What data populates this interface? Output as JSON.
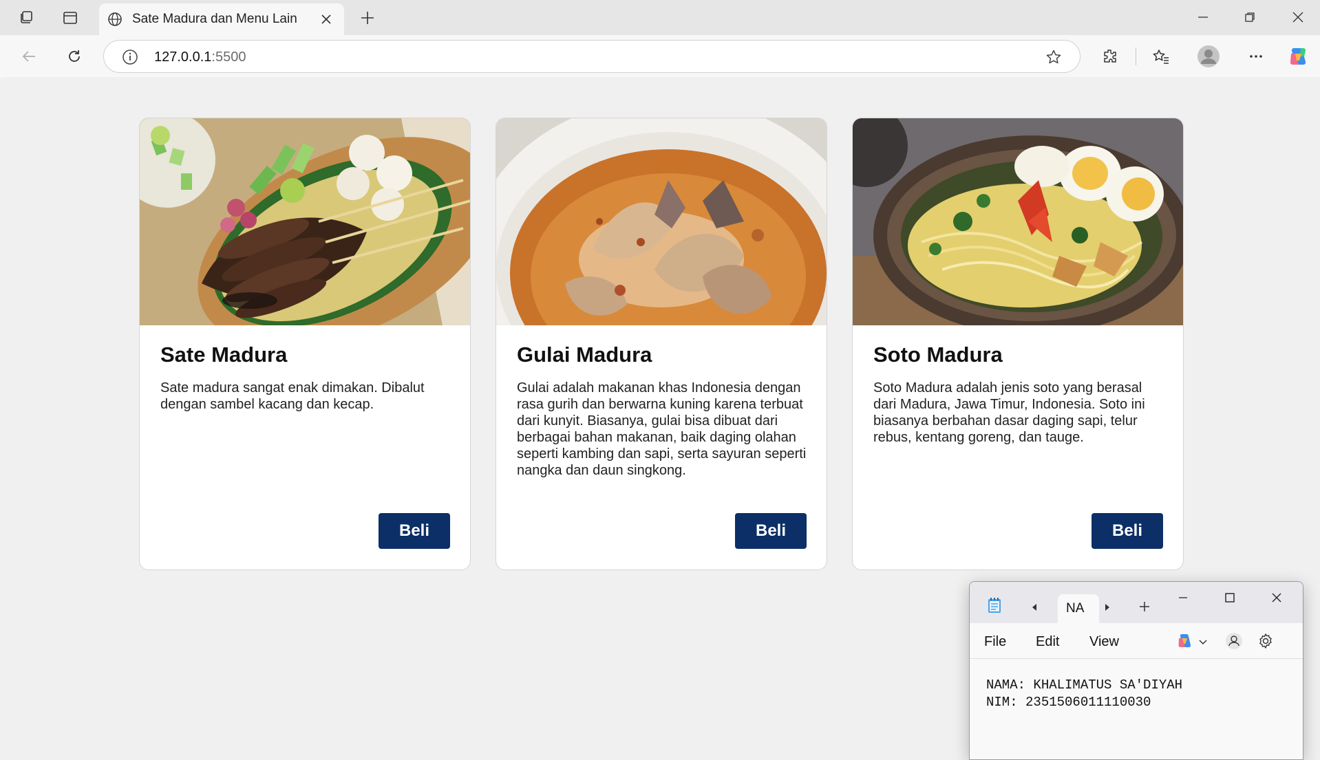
{
  "browser": {
    "tab_title": "Sate Madura dan Menu Lain",
    "url_host": "127.0.0.1",
    "url_port": ":5500"
  },
  "cards": [
    {
      "title": "Sate Madura",
      "description": "Sate madura sangat enak dimakan. Dibalut dengan sambel kacang dan kecap.",
      "button": "Beli",
      "image_subject": "satay skewers on banana leaf plate"
    },
    {
      "title": "Gulai Madura",
      "description": "Gulai adalah makanan khas Indonesia dengan rasa gurih dan berwarna kuning karena terbuat dari kunyit. Biasanya, gulai bisa dibuat dari berbagai bahan makanan, baik daging olahan seperti kambing dan sapi, serta sayuran seperti nangka dan daun singkong.",
      "button": "Beli",
      "image_subject": "curry soup in white bowl"
    },
    {
      "title": "Soto Madura",
      "description": "Soto Madura adalah jenis soto yang berasal dari Madura, Jawa Timur, Indonesia. Soto ini biasanya berbahan dasar daging sapi, telur rebus, kentang goreng, dan tauge.",
      "button": "Beli",
      "image_subject": "noodle soup with eggs in stone bowl"
    }
  ],
  "notepad": {
    "tab_label": "NA",
    "menu": [
      "File",
      "Edit",
      "View"
    ],
    "line1": "NAMA: KHALIMATUS SA'DIYAH",
    "line2": "NIM: 2351506011110030"
  },
  "colors": {
    "button_bg": "#0b2f66",
    "page_bg": "#f0f0f0"
  }
}
